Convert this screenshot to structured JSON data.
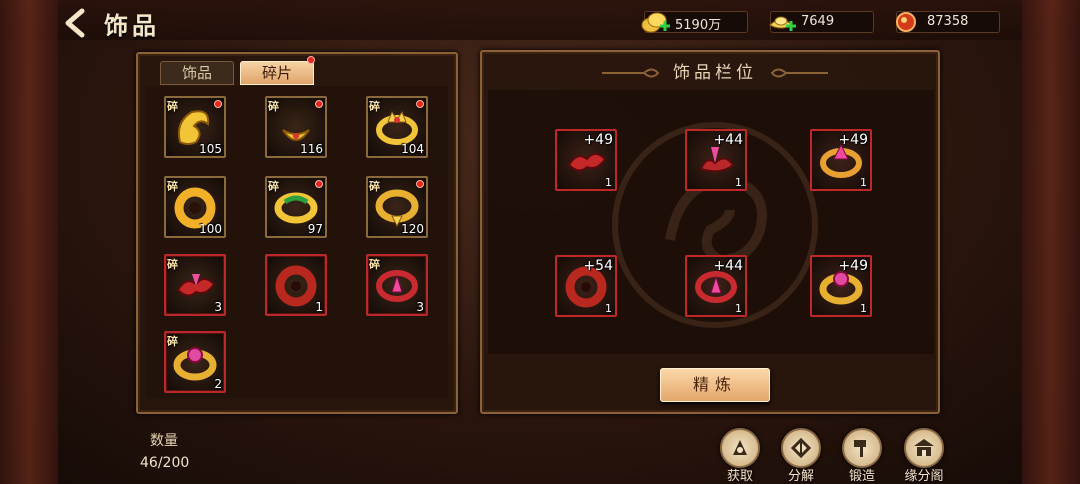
{
  "header": {
    "title": "饰品"
  },
  "resources": [
    {
      "name": "gold-coins",
      "value": "5190万"
    },
    {
      "name": "silver-ingots",
      "value": "7649"
    },
    {
      "name": "gems",
      "value": "87358"
    }
  ],
  "tabs": [
    {
      "label": "饰品",
      "active": false
    },
    {
      "label": "碎片",
      "active": true,
      "has_dot": true
    }
  ],
  "fragment_label": "碎",
  "inventory": [
    {
      "icon": "gold-dragon-pendant-icon",
      "count": "105",
      "dot": true,
      "rare": false
    },
    {
      "icon": "gold-dragon-necklace-icon",
      "count": "116",
      "dot": true,
      "rare": false
    },
    {
      "icon": "gold-crown-ring-icon",
      "count": "104",
      "dot": true,
      "rare": false
    },
    {
      "icon": "gold-coiled-ring-icon",
      "count": "100",
      "dot": false,
      "rare": false
    },
    {
      "icon": "jade-bangle-icon",
      "count": "97",
      "dot": true,
      "rare": false
    },
    {
      "icon": "gold-bangle-icon",
      "count": "120",
      "dot": true,
      "rare": false
    },
    {
      "icon": "red-phoenix-pendant-icon",
      "count": "3",
      "dot": false,
      "rare": true
    },
    {
      "icon": "red-coiled-pendant-icon",
      "count": "1",
      "dot": false,
      "rare": true
    },
    {
      "icon": "red-crystal-ring-icon",
      "count": "3",
      "dot": false,
      "rare": true
    },
    {
      "icon": "gold-gem-ring-icon",
      "count": "2",
      "dot": false,
      "rare": true
    }
  ],
  "slot_panel": {
    "title": "饰品栏位",
    "slots": [
      {
        "icon": "red-phoenix-pendant-icon",
        "level": "+49",
        "count": "1"
      },
      {
        "icon": "red-crystal-brooch-icon",
        "level": "+44",
        "count": "1"
      },
      {
        "icon": "red-gold-ring-icon",
        "level": "+49",
        "count": "1"
      },
      {
        "icon": "red-coiled-pendant-icon",
        "level": "+54",
        "count": "1"
      },
      {
        "icon": "red-crystal-ring-icon",
        "level": "+44",
        "count": "1"
      },
      {
        "icon": "gold-gem-ring-icon",
        "level": "+49",
        "count": "1"
      }
    ],
    "refine_label": "精炼"
  },
  "quantity": {
    "label": "数量",
    "value": "46/200"
  },
  "actions": [
    {
      "label": "获取",
      "icon": "acquire-icon"
    },
    {
      "label": "分解",
      "icon": "decompose-icon"
    },
    {
      "label": "锻造",
      "icon": "forge-hammer-icon"
    },
    {
      "label": "缘分阁",
      "icon": "pavilion-icon"
    }
  ],
  "colors": {
    "gold": "#f0c040",
    "red": "#c0302a",
    "panel_border": "#8a6236",
    "accent_button": "#e4a66c"
  }
}
